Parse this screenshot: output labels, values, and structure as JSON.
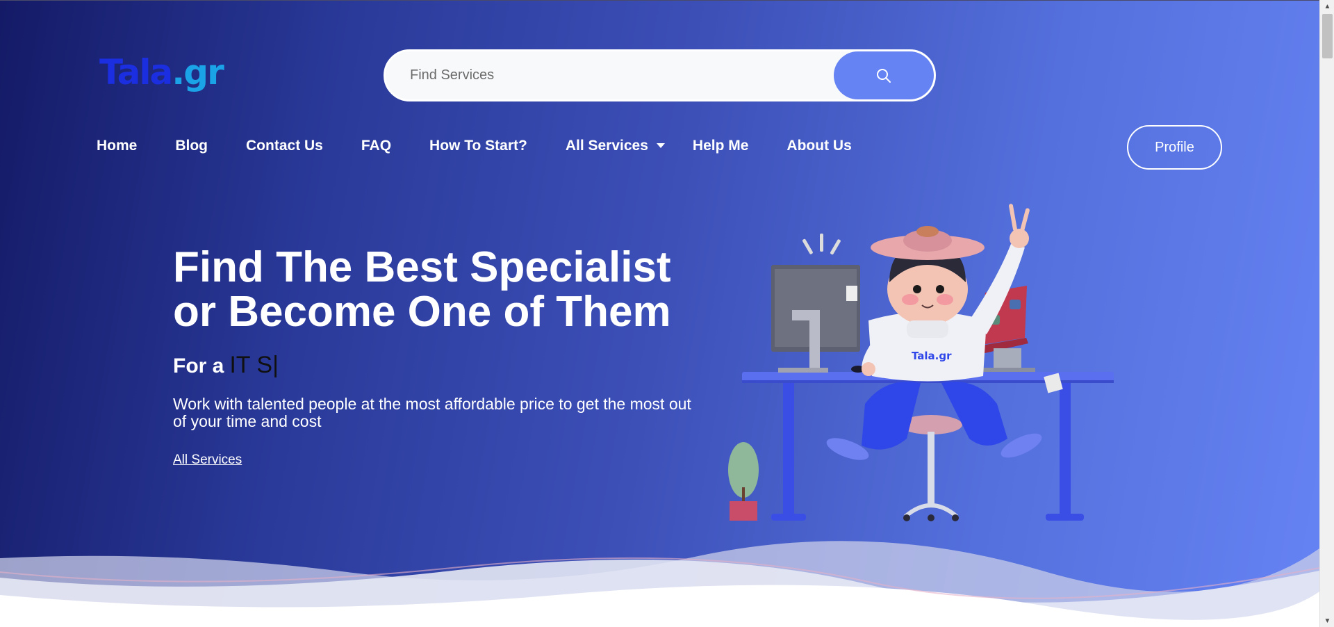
{
  "logo": {
    "text_main": "Tala",
    "text_suffix": ".gr"
  },
  "search": {
    "placeholder": "Find Services",
    "icon": "search-icon"
  },
  "nav": {
    "items": [
      {
        "label": "Home"
      },
      {
        "label": "Blog"
      },
      {
        "label": "Contact Us"
      },
      {
        "label": "FAQ"
      },
      {
        "label": "How To Start?"
      },
      {
        "label": "All Services",
        "icon": "caret-down-icon"
      },
      {
        "label": "Help Me"
      },
      {
        "label": "About Us"
      }
    ],
    "profile_label": "Profile"
  },
  "hero": {
    "headline_line1": "Find The Best Specialist",
    "headline_line2": "or Become One of Them",
    "sub_prefix": "For a",
    "sub_typed": "IT S",
    "sub_cursor": "|",
    "description": "Work with talented people at the most affordable price to get the most out of your time and cost",
    "link_label": "All Services",
    "illustration_badge": "Tala.gr"
  },
  "colors": {
    "gradient_start": "#141a66",
    "gradient_end": "#6683f4",
    "accent": "#6683f4",
    "logo_primary": "#1b2ee0",
    "logo_secondary": "#1ba3e8"
  }
}
